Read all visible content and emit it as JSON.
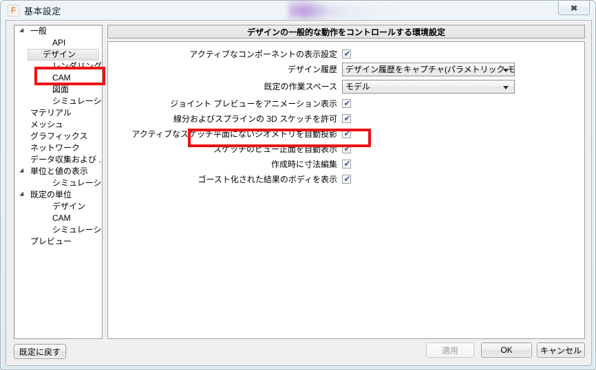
{
  "window": {
    "title": "基本設定",
    "app_icon": "F",
    "close_icon": "✖"
  },
  "sidebar": {
    "items": [
      {
        "label": "一般",
        "level": 0,
        "expanded": true,
        "selected": false
      },
      {
        "label": "API",
        "level": 1,
        "expanded": false,
        "selected": false
      },
      {
        "label": "デザイン",
        "level": 1,
        "expanded": false,
        "selected": true
      },
      {
        "label": "レンダリング",
        "level": 1,
        "expanded": false,
        "selected": false
      },
      {
        "label": "CAM",
        "level": 1,
        "expanded": false,
        "selected": false
      },
      {
        "label": "図面",
        "level": 1,
        "expanded": false,
        "selected": false
      },
      {
        "label": "シミュレーション",
        "level": 1,
        "expanded": false,
        "selected": false
      },
      {
        "label": "マテリアル",
        "level": 0,
        "expanded": false,
        "selected": false
      },
      {
        "label": "メッシュ",
        "level": 0,
        "expanded": false,
        "selected": false
      },
      {
        "label": "グラフィックス",
        "level": 0,
        "expanded": false,
        "selected": false
      },
      {
        "label": "ネットワーク",
        "level": 0,
        "expanded": false,
        "selected": false
      },
      {
        "label": "データ収集および ...",
        "level": 0,
        "expanded": false,
        "selected": false
      },
      {
        "label": "単位と値の表示",
        "level": 0,
        "expanded": true,
        "selected": false
      },
      {
        "label": "シミュレーション",
        "level": 1,
        "expanded": false,
        "selected": false
      },
      {
        "label": "既定の単位",
        "level": 0,
        "expanded": true,
        "selected": false
      },
      {
        "label": "デザイン",
        "level": 1,
        "expanded": false,
        "selected": false
      },
      {
        "label": "CAM",
        "level": 1,
        "expanded": false,
        "selected": false
      },
      {
        "label": "シミュレーション",
        "level": 1,
        "expanded": false,
        "selected": false
      },
      {
        "label": "プレビュー",
        "level": 0,
        "expanded": false,
        "selected": false
      }
    ]
  },
  "main": {
    "group_header": "デザインの一般的な動作をコントロールする環境設定",
    "rows": [
      {
        "label": "アクティブなコンポーネントの表示設定",
        "type": "checkbox",
        "checked": true
      },
      {
        "label": "デザイン履歴",
        "type": "combo",
        "value": "デザイン履歴をキャプチャ(パラメトリック モデル)"
      },
      {
        "label": "既定の作業スペース",
        "type": "combo",
        "value": "モデル"
      },
      {
        "label": "ジョイント プレビューをアニメーション表示",
        "type": "checkbox",
        "checked": true
      },
      {
        "label": "線分およびスプラインの 3D スケッチを許可",
        "type": "checkbox",
        "checked": true
      },
      {
        "label": "アクティブなスケッチ平面にないジオメトリを自動投影",
        "type": "checkbox",
        "checked": true
      },
      {
        "label": "スケッチのビュー正面を自動表示",
        "type": "checkbox",
        "checked": true
      },
      {
        "label": "作成時に寸法編集",
        "type": "checkbox",
        "checked": true
      },
      {
        "label": "ゴースト化された結果のボディを表示",
        "type": "checkbox",
        "checked": true
      }
    ],
    "check_glyph": "✔"
  },
  "footer": {
    "reset_label": "既定に戻す",
    "apply_label": "適用",
    "ok_label": "OK",
    "cancel_label": "キャンセル"
  },
  "annotations": {
    "highlight_color": "#ee1111",
    "targets": [
      "sidebar-item-design",
      "row-allow-3d-sketch"
    ]
  }
}
